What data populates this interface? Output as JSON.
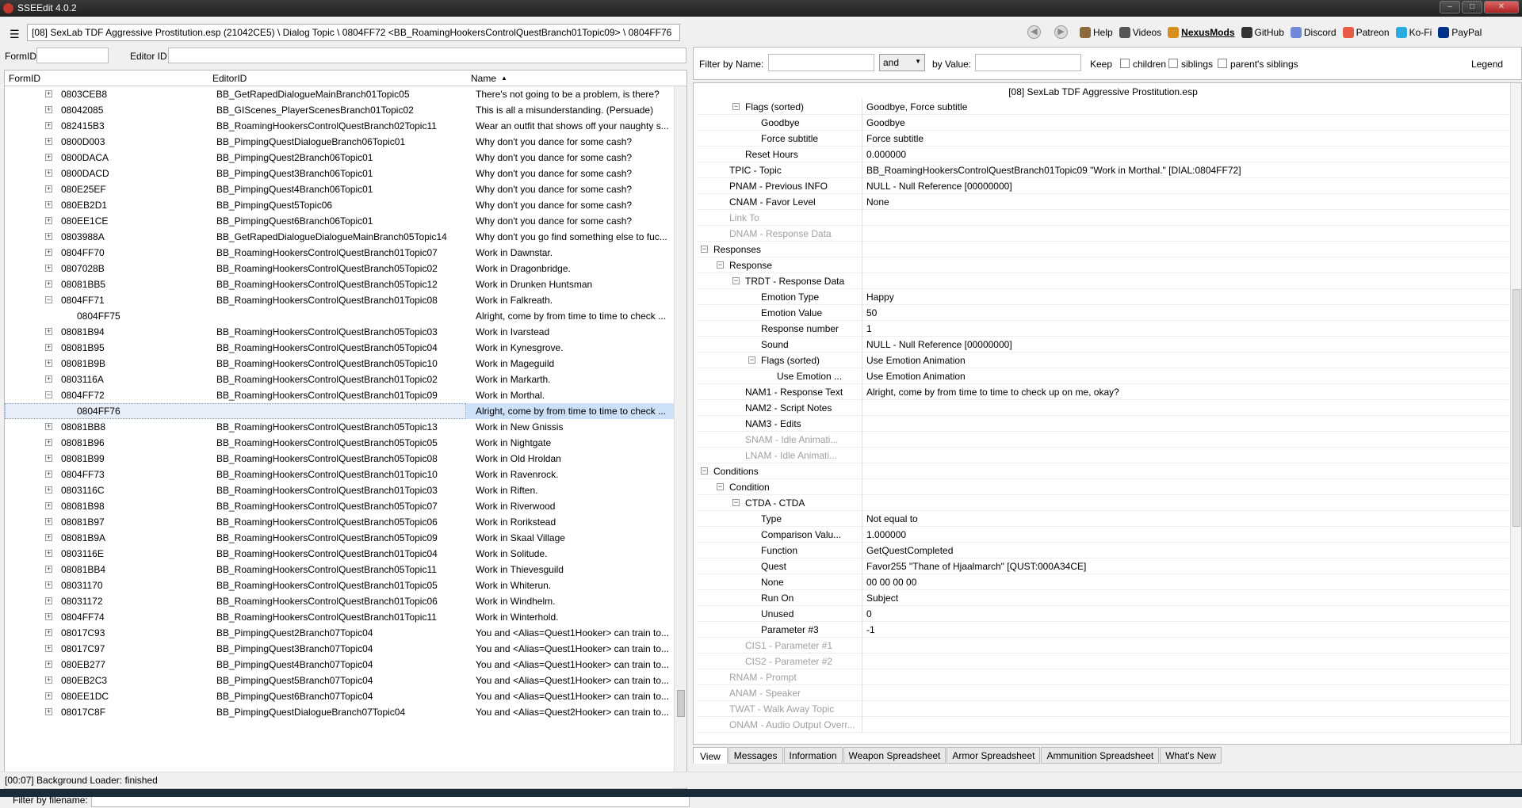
{
  "window": {
    "title": "SSEEdit 4.0.2"
  },
  "toolbar": {
    "path": "[08] SexLab TDF Aggressive Prostitution.esp (21042CE5) \\ Dialog Topic \\ 0804FF72 <BB_RoamingHookersControlQuestBranch01Topic09> \\ 0804FF76",
    "links": [
      {
        "label": "Help",
        "icon": "book-icon",
        "color": "#8b6b3d"
      },
      {
        "label": "Videos",
        "icon": "video-icon",
        "color": "#555555"
      },
      {
        "label": "NexusMods",
        "icon": "nexus-icon",
        "color": "#d98f1e"
      },
      {
        "label": "GitHub",
        "icon": "github-icon",
        "color": "#333333"
      },
      {
        "label": "Discord",
        "icon": "discord-icon",
        "color": "#7289da"
      },
      {
        "label": "Patreon",
        "icon": "patreon-icon",
        "color": "#e85b46"
      },
      {
        "label": "Ko-Fi",
        "icon": "kofi-icon",
        "color": "#29abe0"
      },
      {
        "label": "PayPal",
        "icon": "paypal-icon",
        "color": "#003087"
      }
    ]
  },
  "left": {
    "formid_label": "FormID",
    "editorid_label": "Editor ID",
    "columns": [
      "FormID",
      "EditorID",
      "Name"
    ],
    "sort_indicator": "▲",
    "rows": [
      {
        "indent": 1,
        "exp": "+",
        "formid": "0803CEB8",
        "editorid": "BB_GetRapedDialogueMainBranch01Topic05",
        "name": "There's not going to be a problem, is there?"
      },
      {
        "indent": 1,
        "exp": "+",
        "formid": "08042085",
        "editorid": "BB_GIScenes_PlayerScenesBranch01Topic02",
        "name": "This is all a misunderstanding. (Persuade)"
      },
      {
        "indent": 1,
        "exp": "+",
        "formid": "082415B3",
        "editorid": "BB_RoamingHookersControlQuestBranch02Topic11",
        "name": "Wear an outfit that shows off your naughty s..."
      },
      {
        "indent": 1,
        "exp": "+",
        "formid": "0800D003",
        "editorid": "BB_PimpingQuestDialogueBranch06Topic01",
        "name": "Why don't you dance for some cash?"
      },
      {
        "indent": 1,
        "exp": "+",
        "formid": "0800DACA",
        "editorid": "BB_PimpingQuest2Branch06Topic01",
        "name": "Why don't you dance for some cash?"
      },
      {
        "indent": 1,
        "exp": "+",
        "formid": "0800DACD",
        "editorid": "BB_PimpingQuest3Branch06Topic01",
        "name": "Why don't you dance for some cash?"
      },
      {
        "indent": 1,
        "exp": "+",
        "formid": "080E25EF",
        "editorid": "BB_PimpingQuest4Branch06Topic01",
        "name": "Why don't you dance for some cash?"
      },
      {
        "indent": 1,
        "exp": "+",
        "formid": "080EB2D1",
        "editorid": "BB_PimpingQuest5Topic06",
        "name": "Why don't you dance for some cash?"
      },
      {
        "indent": 1,
        "exp": "+",
        "formid": "080EE1CE",
        "editorid": "BB_PimpingQuest6Branch06Topic01",
        "name": "Why don't you dance for some cash?"
      },
      {
        "indent": 1,
        "exp": "+",
        "formid": "0803988A",
        "editorid": "BB_GetRapedDialogueDialogueMainBranch05Topic14",
        "name": "Why don't you go find something else to fuc..."
      },
      {
        "indent": 1,
        "exp": "+",
        "formid": "0804FF70",
        "editorid": "BB_RoamingHookersControlQuestBranch01Topic07",
        "name": "Work in Dawnstar."
      },
      {
        "indent": 1,
        "exp": "+",
        "formid": "0807028B",
        "editorid": "BB_RoamingHookersControlQuestBranch05Topic02",
        "name": "Work in Dragonbridge."
      },
      {
        "indent": 1,
        "exp": "+",
        "formid": "08081BB5",
        "editorid": "BB_RoamingHookersControlQuestBranch05Topic12",
        "name": "Work in Drunken Huntsman"
      },
      {
        "indent": 1,
        "exp": "−",
        "formid": "0804FF71",
        "editorid": "BB_RoamingHookersControlQuestBranch01Topic08",
        "name": "Work in Falkreath."
      },
      {
        "indent": 2,
        "exp": "",
        "formid": "0804FF75",
        "editorid": "",
        "name": "Alright, come by from time to time to check ..."
      },
      {
        "indent": 1,
        "exp": "+",
        "formid": "08081B94",
        "editorid": "BB_RoamingHookersControlQuestBranch05Topic03",
        "name": "Work in Ivarstead"
      },
      {
        "indent": 1,
        "exp": "+",
        "formid": "08081B95",
        "editorid": "BB_RoamingHookersControlQuestBranch05Topic04",
        "name": "Work in Kynesgrove."
      },
      {
        "indent": 1,
        "exp": "+",
        "formid": "08081B9B",
        "editorid": "BB_RoamingHookersControlQuestBranch05Topic10",
        "name": "Work in Mageguild"
      },
      {
        "indent": 1,
        "exp": "+",
        "formid": "0803116A",
        "editorid": "BB_RoamingHookersControlQuestBranch01Topic02",
        "name": "Work in Markarth."
      },
      {
        "indent": 1,
        "exp": "−",
        "formid": "0804FF72",
        "editorid": "BB_RoamingHookersControlQuestBranch01Topic09",
        "name": "Work in Morthal."
      },
      {
        "indent": 2,
        "exp": "",
        "formid": "0804FF76",
        "editorid": "",
        "name": "Alright, come by from time to time to check ...",
        "selected": true
      },
      {
        "indent": 1,
        "exp": "+",
        "formid": "08081BB8",
        "editorid": "BB_RoamingHookersControlQuestBranch05Topic13",
        "name": "Work in New Gnissis"
      },
      {
        "indent": 1,
        "exp": "+",
        "formid": "08081B96",
        "editorid": "BB_RoamingHookersControlQuestBranch05Topic05",
        "name": "Work in Nightgate"
      },
      {
        "indent": 1,
        "exp": "+",
        "formid": "08081B99",
        "editorid": "BB_RoamingHookersControlQuestBranch05Topic08",
        "name": "Work in Old Hroldan"
      },
      {
        "indent": 1,
        "exp": "+",
        "formid": "0804FF73",
        "editorid": "BB_RoamingHookersControlQuestBranch01Topic10",
        "name": "Work in Ravenrock."
      },
      {
        "indent": 1,
        "exp": "+",
        "formid": "0803116C",
        "editorid": "BB_RoamingHookersControlQuestBranch01Topic03",
        "name": "Work in Riften."
      },
      {
        "indent": 1,
        "exp": "+",
        "formid": "08081B98",
        "editorid": "BB_RoamingHookersControlQuestBranch05Topic07",
        "name": "Work in Riverwood"
      },
      {
        "indent": 1,
        "exp": "+",
        "formid": "08081B97",
        "editorid": "BB_RoamingHookersControlQuestBranch05Topic06",
        "name": "Work in Rorikstead"
      },
      {
        "indent": 1,
        "exp": "+",
        "formid": "08081B9A",
        "editorid": "BB_RoamingHookersControlQuestBranch05Topic09",
        "name": "Work in Skaal Village"
      },
      {
        "indent": 1,
        "exp": "+",
        "formid": "0803116E",
        "editorid": "BB_RoamingHookersControlQuestBranch01Topic04",
        "name": "Work in Solitude."
      },
      {
        "indent": 1,
        "exp": "+",
        "formid": "08081BB4",
        "editorid": "BB_RoamingHookersControlQuestBranch05Topic11",
        "name": "Work in Thievesguild"
      },
      {
        "indent": 1,
        "exp": "+",
        "formid": "08031170",
        "editorid": "BB_RoamingHookersControlQuestBranch01Topic05",
        "name": "Work in Whiterun."
      },
      {
        "indent": 1,
        "exp": "+",
        "formid": "08031172",
        "editorid": "BB_RoamingHookersControlQuestBranch01Topic06",
        "name": "Work in Windhelm."
      },
      {
        "indent": 1,
        "exp": "+",
        "formid": "0804FF74",
        "editorid": "BB_RoamingHookersControlQuestBranch01Topic11",
        "name": "Work in Winterhold."
      },
      {
        "indent": 1,
        "exp": "+",
        "formid": "08017C93",
        "editorid": "BB_PimpingQuest2Branch07Topic04",
        "name": "You and <Alias=Quest1Hooker> can train to..."
      },
      {
        "indent": 1,
        "exp": "+",
        "formid": "08017C97",
        "editorid": "BB_PimpingQuest3Branch07Topic04",
        "name": "You and <Alias=Quest1Hooker> can train to..."
      },
      {
        "indent": 1,
        "exp": "+",
        "formid": "080EB277",
        "editorid": "BB_PimpingQuest4Branch07Topic04",
        "name": "You and <Alias=Quest1Hooker> can train to..."
      },
      {
        "indent": 1,
        "exp": "+",
        "formid": "080EB2C3",
        "editorid": "BB_PimpingQuest5Branch07Topic04",
        "name": "You and <Alias=Quest1Hooker> can train to..."
      },
      {
        "indent": 1,
        "exp": "+",
        "formid": "080EE1DC",
        "editorid": "BB_PimpingQuest6Branch07Topic04",
        "name": "You and <Alias=Quest1Hooker> can train to..."
      },
      {
        "indent": 1,
        "exp": "+",
        "formid": "08017C8F",
        "editorid": "BB_PimpingQuestDialogueBranch07Topic04",
        "name": "You and <Alias=Quest2Hooker> can train to..."
      }
    ],
    "filter_label": "Filter by filename:"
  },
  "right": {
    "filter": {
      "by_name": "Filter by Name:",
      "and_or": "and",
      "by_value": "by Value:",
      "keep": "Keep",
      "children": "children",
      "siblings": "siblings",
      "parents_siblings": "parent's siblings",
      "legend": "Legend"
    },
    "header": "[08] SexLab TDF Aggressive Prostitution.esp",
    "rows": [
      {
        "level": 1,
        "exp": "−",
        "name": "Flags (sorted)",
        "value": "Goodbye, Force subtitle"
      },
      {
        "level": 2,
        "exp": "",
        "name": "Goodbye",
        "value": "Goodbye"
      },
      {
        "level": 2,
        "exp": "",
        "name": "Force subtitle",
        "value": "Force subtitle"
      },
      {
        "level": 1,
        "exp": "",
        "name": "Reset Hours",
        "value": "0.000000"
      },
      {
        "level": 0,
        "exp": "",
        "name": "TPIC - Topic",
        "value": "BB_RoamingHookersControlQuestBranch01Topic09 \"Work in Morthal.\" [DIAL:0804FF72]"
      },
      {
        "level": 0,
        "exp": "",
        "name": "PNAM - Previous INFO",
        "value": "NULL - Null Reference [00000000]"
      },
      {
        "level": 0,
        "exp": "",
        "name": "CNAM - Favor Level",
        "value": "None"
      },
      {
        "level": 0,
        "exp": "",
        "name": "Link To",
        "value": "",
        "gray": true
      },
      {
        "level": 0,
        "exp": "",
        "name": "DNAM - Response Data",
        "value": "",
        "gray": true
      },
      {
        "level": -1,
        "exp": "−",
        "name": "Responses",
        "value": ""
      },
      {
        "level": 0,
        "exp": "−",
        "name": "Response",
        "value": ""
      },
      {
        "level": 1,
        "exp": "−",
        "name": "TRDT - Response Data",
        "value": ""
      },
      {
        "level": 2,
        "exp": "",
        "name": "Emotion Type",
        "value": "Happy"
      },
      {
        "level": 2,
        "exp": "",
        "name": "Emotion Value",
        "value": "50"
      },
      {
        "level": 2,
        "exp": "",
        "name": "Response number",
        "value": "1"
      },
      {
        "level": 2,
        "exp": "",
        "name": "Sound",
        "value": "NULL - Null Reference [00000000]"
      },
      {
        "level": 2,
        "exp": "−",
        "name": "Flags (sorted)",
        "value": "Use Emotion Animation"
      },
      {
        "level": 3,
        "exp": "",
        "name": "Use Emotion ...",
        "value": "Use Emotion Animation"
      },
      {
        "level": 1,
        "exp": "",
        "name": "NAM1 - Response Text",
        "value": "Alright, come by from time to time to check up on me, okay?"
      },
      {
        "level": 1,
        "exp": "",
        "name": "NAM2 - Script Notes",
        "value": ""
      },
      {
        "level": 1,
        "exp": "",
        "name": "NAM3 - Edits",
        "value": ""
      },
      {
        "level": 1,
        "exp": "",
        "name": "SNAM - Idle Animati...",
        "value": "",
        "gray": true
      },
      {
        "level": 1,
        "exp": "",
        "name": "LNAM - Idle Animati...",
        "value": "",
        "gray": true
      },
      {
        "level": -1,
        "exp": "−",
        "name": "Conditions",
        "value": ""
      },
      {
        "level": 0,
        "exp": "−",
        "name": "Condition",
        "value": ""
      },
      {
        "level": 1,
        "exp": "−",
        "name": "CTDA - CTDA",
        "value": ""
      },
      {
        "level": 2,
        "exp": "",
        "name": "Type",
        "value": "Not equal to"
      },
      {
        "level": 2,
        "exp": "",
        "name": "Comparison Valu...",
        "value": "1.000000"
      },
      {
        "level": 2,
        "exp": "",
        "name": "Function",
        "value": "GetQuestCompleted"
      },
      {
        "level": 2,
        "exp": "",
        "name": "Quest",
        "value": "Favor255 \"Thane of Hjaalmarch\" [QUST:000A34CE]"
      },
      {
        "level": 2,
        "exp": "",
        "name": "None",
        "value": "00 00 00 00"
      },
      {
        "level": 2,
        "exp": "",
        "name": "Run On",
        "value": "Subject"
      },
      {
        "level": 2,
        "exp": "",
        "name": "Unused",
        "value": "0"
      },
      {
        "level": 2,
        "exp": "",
        "name": "Parameter #3",
        "value": "-1"
      },
      {
        "level": 1,
        "exp": "",
        "name": "CIS1 - Parameter #1",
        "value": "",
        "gray": true
      },
      {
        "level": 1,
        "exp": "",
        "name": "CIS2 - Parameter #2",
        "value": "",
        "gray": true
      },
      {
        "level": 0,
        "exp": "",
        "name": "RNAM - Prompt",
        "value": "",
        "gray": true
      },
      {
        "level": 0,
        "exp": "",
        "name": "ANAM - Speaker",
        "value": "",
        "gray": true
      },
      {
        "level": 0,
        "exp": "",
        "name": "TWAT - Walk Away Topic",
        "value": "",
        "gray": true
      },
      {
        "level": 0,
        "exp": "",
        "name": "ONAM - Audio Output Overr...",
        "value": "",
        "gray": true
      }
    ],
    "tabs": [
      "View",
      "Messages",
      "Information",
      "Weapon Spreadsheet",
      "Armor Spreadsheet",
      "Ammunition Spreadsheet",
      "What's New"
    ]
  },
  "status": "[00:07] Background Loader: finished"
}
